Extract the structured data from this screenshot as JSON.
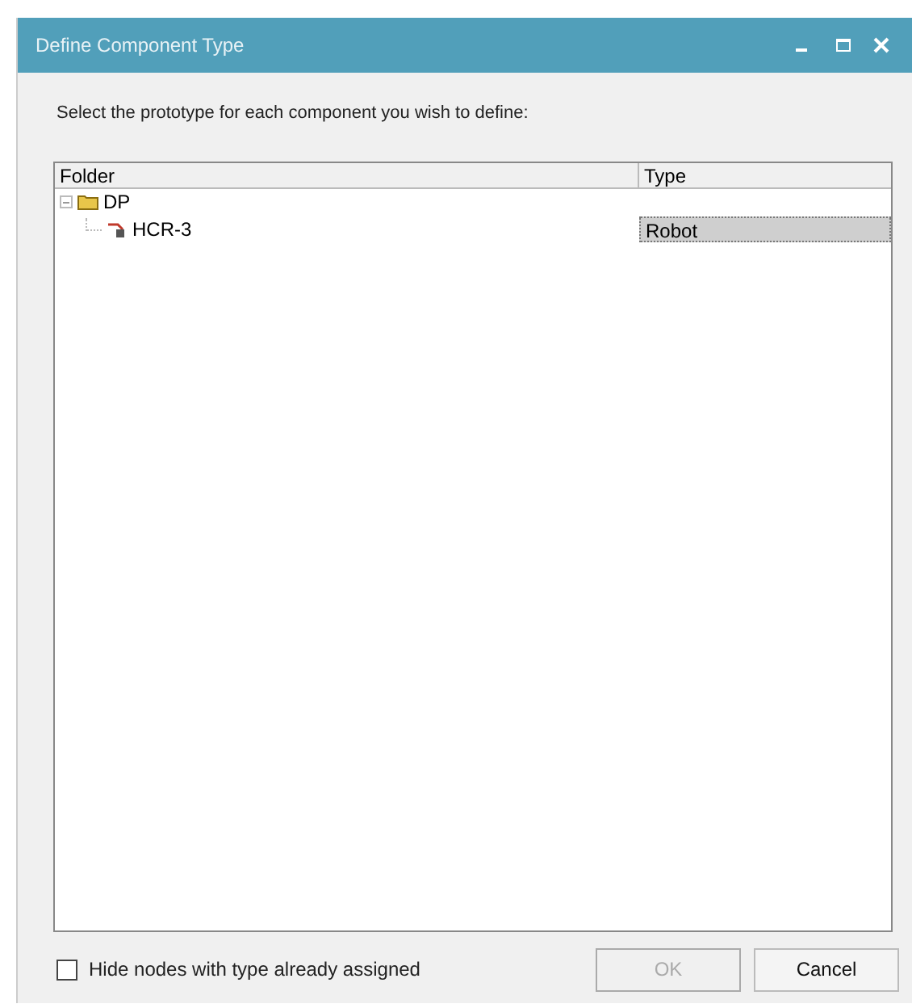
{
  "window": {
    "title": "Define Component Type"
  },
  "instruction": "Select the prototype for each component you wish to define:",
  "table": {
    "columns": [
      "Folder",
      "Type"
    ],
    "rows": [
      {
        "name": "DP",
        "kind": "folder",
        "type": "",
        "expanded": true,
        "selected": false,
        "children": [
          {
            "name": "HCR-3",
            "kind": "component",
            "type": "Robot",
            "selected": true
          }
        ]
      }
    ]
  },
  "hide_assigned": {
    "label": "Hide nodes with type already assigned",
    "checked": false
  },
  "buttons": [
    {
      "label": "OK",
      "disabled": true
    },
    {
      "label": "Cancel",
      "disabled": false
    }
  ]
}
